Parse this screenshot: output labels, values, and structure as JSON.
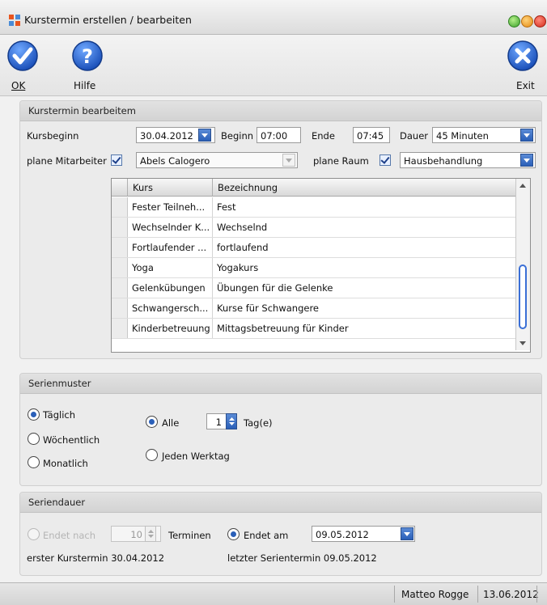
{
  "window": {
    "title": "Kurstermin erstellen / bearbeiten"
  },
  "toolbar": {
    "ok_label": "OK",
    "help_label": "Hilfe",
    "exit_label": "Exit"
  },
  "kurstermin": {
    "header": "Kurstermin bearbeitem",
    "kursbeginn_label": "Kursbeginn",
    "kursbeginn_value": "30.04.2012",
    "beginn_label": "Beginn",
    "beginn_value": "07:00",
    "ende_label": "Ende",
    "ende_value": "07:45",
    "dauer_label": "Dauer",
    "dauer_value": "45 Minuten",
    "mitarbeiter_label": "plane Mitarbeiter",
    "mitarbeiter_value": "Abels Calogero",
    "raum_label": "plane Raum",
    "raum_value": "Hausbehandlung"
  },
  "table": {
    "columns": [
      "Kurs",
      "Bezeichnung"
    ],
    "rows": [
      [
        "Fester Teilneh...",
        "Fest"
      ],
      [
        "Wechselnder K...",
        "Wechselnd"
      ],
      [
        "Fortlaufender ...",
        "fortlaufend"
      ],
      [
        "Yoga",
        "Yogakurs"
      ],
      [
        "Gelenkübungen",
        "Übungen für die Gelenke"
      ],
      [
        "Schwangersch...",
        "Kurse für Schwangere"
      ],
      [
        "Kinderbetreuung",
        "Mittagsbetreuung für Kinder"
      ]
    ]
  },
  "serienmuster": {
    "header": "Serienmuster",
    "taeglich": "Täglich",
    "woechentlich": "Wöchentlich",
    "monatlich": "Monatlich",
    "alle": "Alle",
    "interval_value": "1",
    "tage_label": "Tag(e)",
    "jeden_werktag": "Jeden Werktag"
  },
  "seriendauer": {
    "header": "Seriendauer",
    "endet_nach": "Endet nach",
    "termine_value": "10",
    "terminen_label": "Terminen",
    "endet_am": "Endet am",
    "endet_am_value": "09.05.2012",
    "erster_termin": "erster Kurstermin 30.04.2012",
    "letzter_termin": "letzter Serientermin 09.05.2012"
  },
  "status": {
    "user": "Matteo Rogge",
    "date": "13.06.2012"
  },
  "colors": {
    "accent": "#2a5fb8",
    "button_blue": "#1f5fc8"
  }
}
